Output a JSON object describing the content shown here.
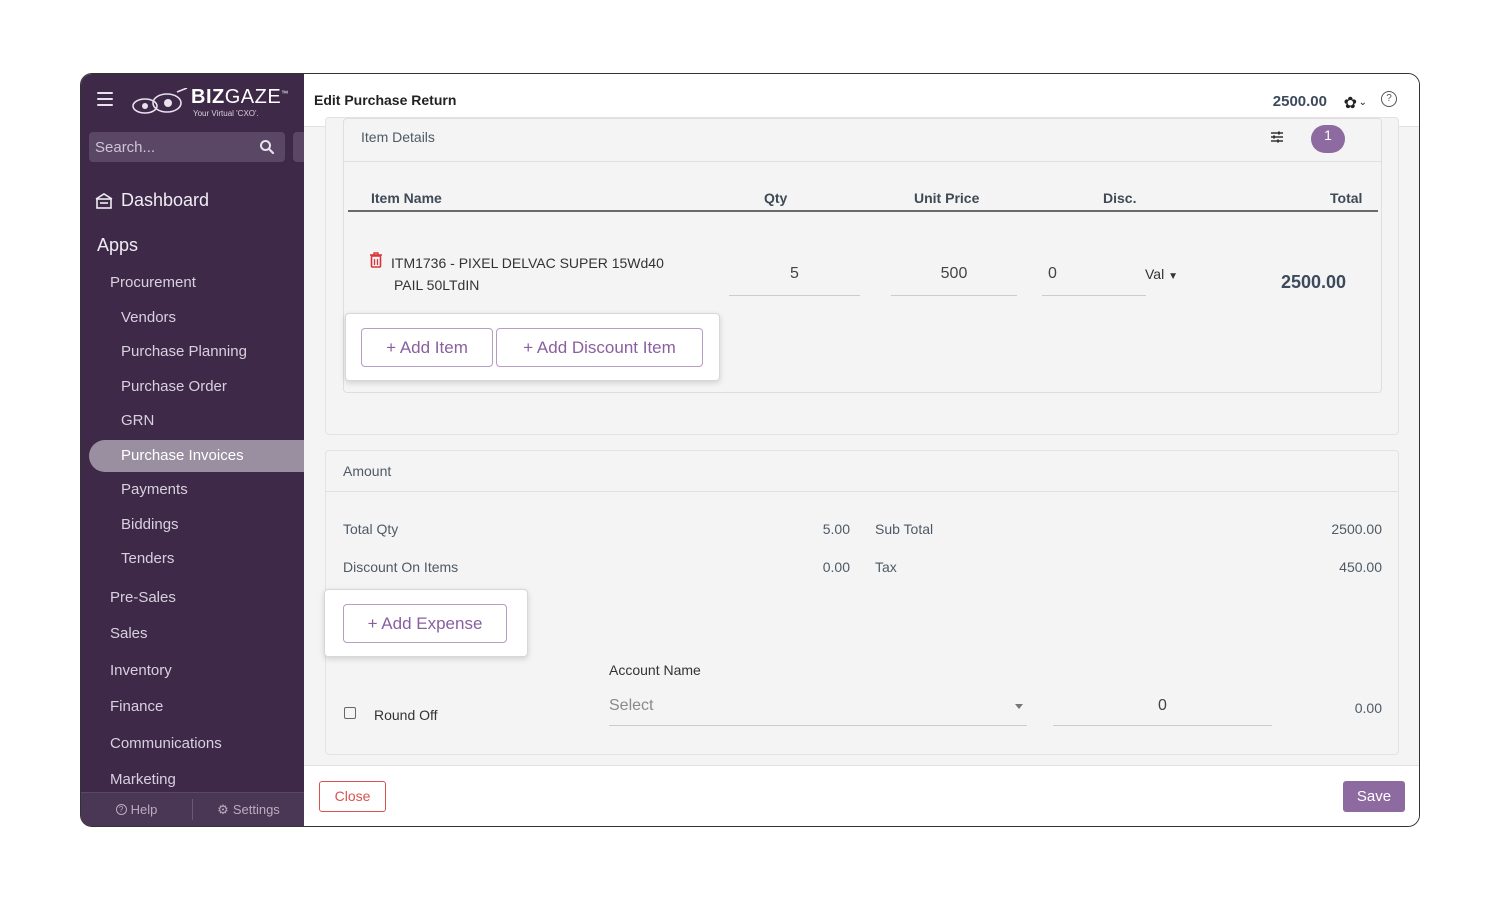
{
  "header": {
    "title": "Edit Purchase Return",
    "amount": "2500.00",
    "help_glyph": "?"
  },
  "sidebar": {
    "logo_main": "BIZ",
    "logo_gaze": "GAZE",
    "logo_tm": "™",
    "logo_sub": "Your Virtual 'CXO'.",
    "search_placeholder": "Search...",
    "dashboard": "Dashboard",
    "apps": "Apps",
    "items": [
      {
        "label": "Procurement"
      },
      {
        "label": "Vendors"
      },
      {
        "label": "Purchase Planning"
      },
      {
        "label": "Purchase Order"
      },
      {
        "label": "GRN"
      },
      {
        "label": "Purchase Invoices"
      },
      {
        "label": "Payments"
      },
      {
        "label": "Biddings"
      },
      {
        "label": "Tenders"
      },
      {
        "label": "Pre-Sales"
      },
      {
        "label": "Sales"
      },
      {
        "label": "Inventory"
      },
      {
        "label": "Finance"
      },
      {
        "label": "Communications"
      },
      {
        "label": "Marketing"
      }
    ],
    "active_item": "Purchase Invoices",
    "footer_help": "Help",
    "footer_settings": "Settings"
  },
  "item_details": {
    "title": "Item Details",
    "count": "1",
    "columns": {
      "name": "Item Name",
      "qty": "Qty",
      "unit_price": "Unit Price",
      "disc": "Disc.",
      "total": "Total"
    },
    "rows": [
      {
        "name_line1": "ITM1736 - PIXEL DELVAC SUPER 15Wd40",
        "name_line2": "PAIL 50LTdIN",
        "qty": "5",
        "unit_price": "500",
        "disc": "0",
        "disc_type": "Val",
        "total": "2500.00"
      }
    ],
    "add_item": "+ Add Item",
    "add_discount_item": "+ Add Discount Item"
  },
  "amount": {
    "title": "Amount",
    "total_qty_label": "Total Qty",
    "total_qty": "5.00",
    "discount_label": "Discount On Items",
    "discount": "0.00",
    "sub_total_label": "Sub Total",
    "sub_total": "2500.00",
    "tax_label": "Tax",
    "tax": "450.00",
    "add_expense": "+ Add Expense",
    "account_name_label": "Account Name",
    "account_select_placeholder": "Select",
    "round_off_label": "Round Off",
    "round_off_input": "0",
    "round_off_value": "0.00"
  },
  "footer": {
    "close": "Close",
    "save": "Save"
  },
  "colors": {
    "sidebar_bg": "#3e2a48",
    "accent": "#8d6a9f",
    "danger": "#d9534f"
  },
  "icons": [
    "hamburger-icon",
    "logo-icon",
    "search-icon",
    "dashboard-icon",
    "gear-icon",
    "chevron-down-icon",
    "help-icon",
    "filter-icon",
    "trash-icon",
    "settings-icon"
  ]
}
